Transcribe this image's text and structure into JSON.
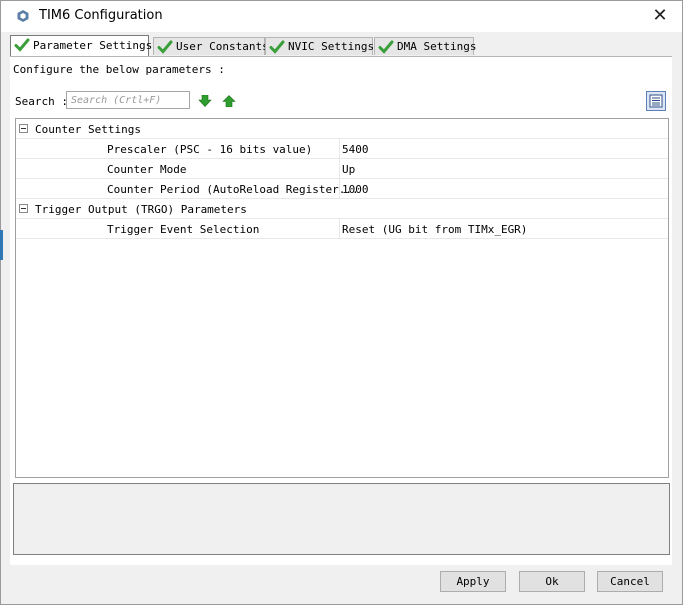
{
  "window": {
    "title": "TIM6 Configuration",
    "close_symbol": "✕"
  },
  "tabs": [
    {
      "label": "Parameter Settings",
      "active": true
    },
    {
      "label": "User Constants",
      "active": false
    },
    {
      "label": "NVIC Settings",
      "active": false
    },
    {
      "label": "DMA Settings",
      "active": false
    }
  ],
  "content": {
    "description": "Configure the below parameters :",
    "search": {
      "label": "Search :",
      "placeholder": "Search (Crtl+F)"
    }
  },
  "tree": {
    "groups": [
      {
        "label": "Counter Settings",
        "params": [
          {
            "name": "Prescaler (PSC - 16 bits value)",
            "value": "5400"
          },
          {
            "name": "Counter Mode",
            "value": "Up"
          },
          {
            "name": "Counter Period (AutoReload Register...",
            "value": "1000"
          }
        ]
      },
      {
        "label": "Trigger Output (TRGO) Parameters",
        "params": [
          {
            "name": "Trigger Event Selection",
            "value": "Reset (UG bit from TIMx_EGR)"
          }
        ]
      }
    ]
  },
  "buttons": {
    "apply": "Apply",
    "ok": "Ok",
    "cancel": "Cancel"
  },
  "colors": {
    "check": "#3a9e3a",
    "accent": "#2f77b5",
    "arrow": "#2e9e2e"
  },
  "icons": {
    "tab_check": "check-icon",
    "down": "arrow-down-icon",
    "up": "arrow-up-icon",
    "view": "list-view-icon"
  }
}
